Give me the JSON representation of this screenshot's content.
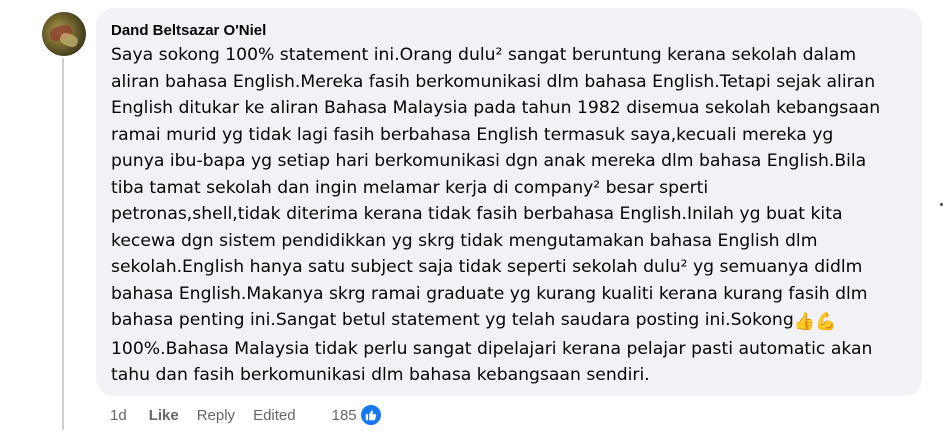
{
  "comment": {
    "author": "Dand Beltsazar O'Niel",
    "lines": [
      "Saya sokong 100% statement ini.Orang dulu² sangat beruntung kerana sekolah dalam",
      "aliran bahasa English.Mereka fasih berkomunikasi dlm bahasa English.Tetapi sejak aliran",
      "English ditukar ke aliran Bahasa Malaysia pada tahun 1982 disemua sekolah kebangsaan",
      "ramai murid yg tidak lagi fasih berbahasa English termasuk saya,kecuali mereka yg",
      "punya ibu-bapa yg setiap hari berkomunikasi dgn anak mereka dlm bahasa English.Bila",
      "tiba tamat sekolah dan ingin melamar kerja di company² besar sperti",
      "petronas,shell,tidak diterima kerana tidak fasih berbahasa English.Inilah yg buat kita",
      "kecewa dgn sistem pendidikkan yg skrg tidak mengutamakan bahasa English dlm",
      "sekolah.English hanya satu subject saja tidak seperti sekolah dulu² yg semuanya didlm",
      "bahasa English.Makanya skrg ramai graduate yg kurang kualiti kerana kurang fasih dlm",
      "bahasa penting ini.Sangat betul statement yg telah saudara posting ini.Sokong",
      "100%.Bahasa Malaysia tidak perlu sangat dipelajari kerana pelajar pasti automatic akan",
      "tahu dan fasih berkomunikasi dlm bahasa kebangsaan sendiri."
    ],
    "emojis": "👍💪"
  },
  "actions": {
    "time": "1d",
    "like_label": "Like",
    "reply_label": "Reply",
    "edited_label": "Edited",
    "reaction_count": "185",
    "reaction_icon": "thumbs-up-icon"
  },
  "colors": {
    "bubble": "#f0f2f5",
    "text": "#050505",
    "secondary": "#65676b",
    "like_blue": "#1877f2"
  }
}
